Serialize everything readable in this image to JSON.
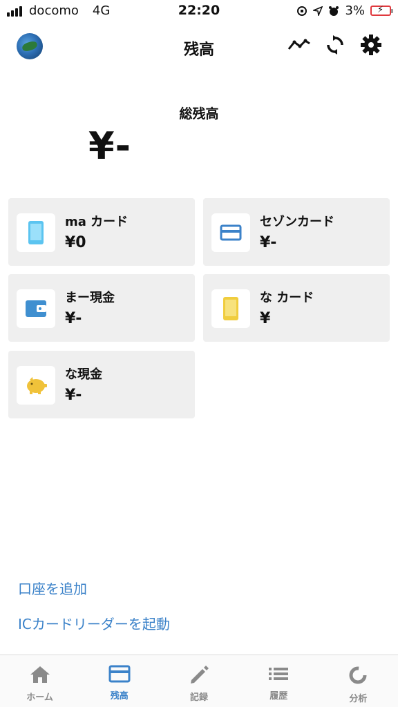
{
  "status_bar": {
    "carrier": "docomo",
    "network": "4G",
    "time": "22:20",
    "battery": "3%"
  },
  "header": {
    "title": "残高"
  },
  "total": {
    "label": "総残高",
    "value": "¥-"
  },
  "accounts": [
    {
      "name": "ma カード",
      "amount": "¥0",
      "icon": "smartphone-icon",
      "color": "#5bc4f0"
    },
    {
      "name": "セゾンカード",
      "amount": "¥-",
      "icon": "credit-card-icon",
      "color": "#3b82c9"
    },
    {
      "name": "まー現金",
      "amount": "¥-",
      "icon": "wallet-icon",
      "color": "#3f8fd0"
    },
    {
      "name": "な カード",
      "amount": "¥",
      "icon": "smartphone-icon",
      "color": "#f0cd3e"
    },
    {
      "name": "な現金",
      "amount": "¥-",
      "icon": "piggy-bank-icon",
      "color": "#f0c23a"
    }
  ],
  "links": {
    "add_account": "口座を追加",
    "ic_reader": "ICカードリーダーを起動"
  },
  "tabs": [
    {
      "label": "ホーム",
      "icon": "home-icon"
    },
    {
      "label": "残高",
      "icon": "credit-card-icon",
      "active": true
    },
    {
      "label": "記録",
      "icon": "pencil-icon"
    },
    {
      "label": "履歴",
      "icon": "list-icon"
    },
    {
      "label": "分析",
      "icon": "donut-chart-icon"
    }
  ],
  "colors": {
    "accent": "#3b82c9",
    "card_bg": "#efefef",
    "inactive_tab": "#8a8a8a"
  }
}
